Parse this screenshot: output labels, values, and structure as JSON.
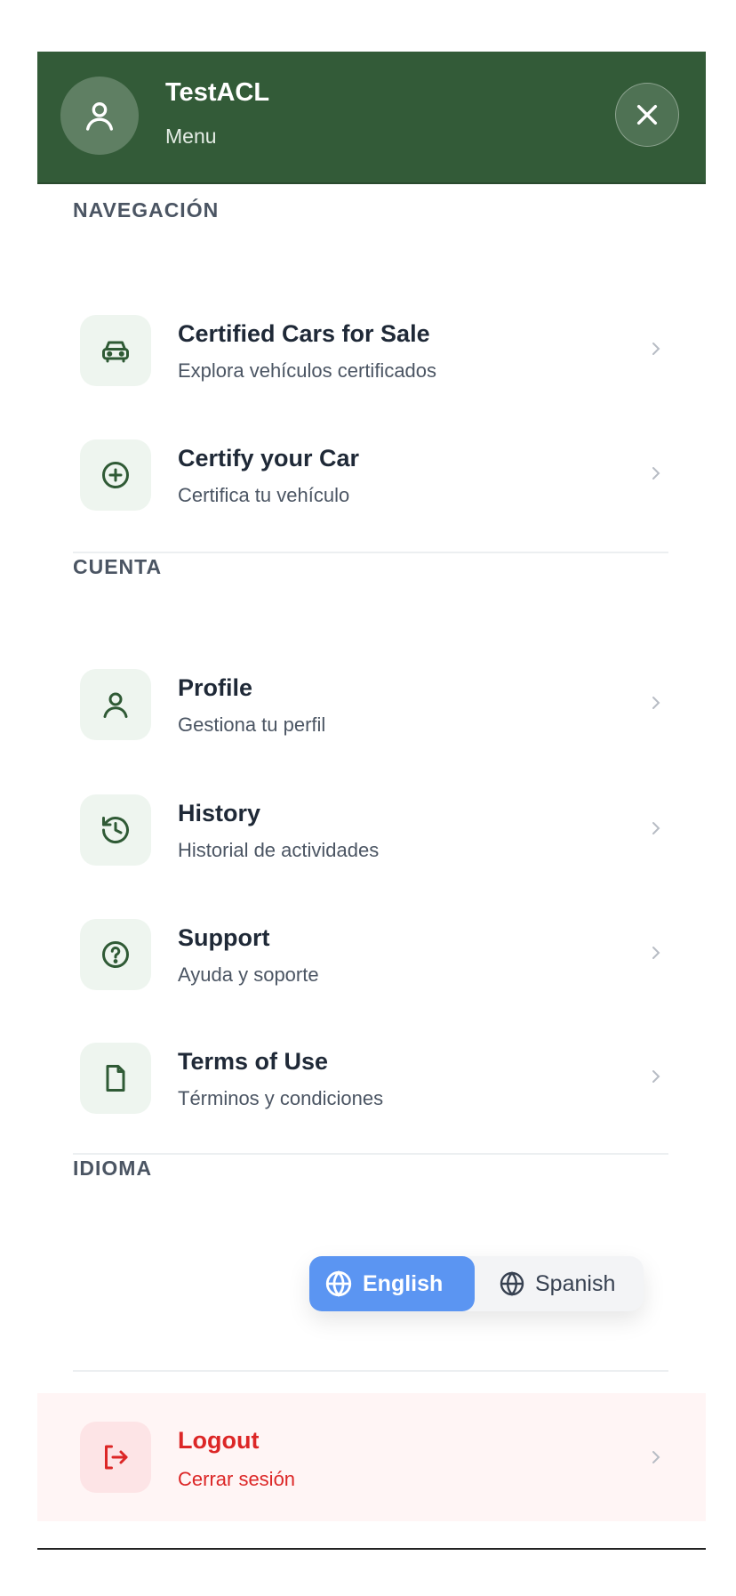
{
  "header": {
    "user_name": "TestACL",
    "subtitle": "Menu"
  },
  "sections": {
    "navigation": {
      "title": "NAVEGACIÓN",
      "items": [
        {
          "label": "Certified Cars for Sale",
          "description": "Explora vehículos certificados",
          "icon": "car-icon"
        },
        {
          "label": "Certify your Car",
          "description": "Certifica tu vehículo",
          "icon": "plus-circle-icon"
        }
      ]
    },
    "account": {
      "title": "CUENTA",
      "items": [
        {
          "label": "Profile",
          "description": "Gestiona tu perfil",
          "icon": "user-icon"
        },
        {
          "label": "History",
          "description": "Historial de actividades",
          "icon": "history-icon"
        },
        {
          "label": "Support",
          "description": "Ayuda y soporte",
          "icon": "help-circle-icon"
        },
        {
          "label": "Terms of Use",
          "description": "Términos y condiciones",
          "icon": "file-icon"
        }
      ]
    },
    "language": {
      "title": "IDIOMA",
      "options": [
        {
          "label": "English",
          "selected": true
        },
        {
          "label": "Spanish",
          "selected": false
        }
      ]
    }
  },
  "logout": {
    "label": "Logout",
    "description": "Cerrar sesión",
    "icon": "logout-icon"
  },
  "colors": {
    "header_bg": "#335b38",
    "icon_green": "#2f5a35",
    "accent_blue": "#5b95f2",
    "danger": "#dc2626"
  }
}
